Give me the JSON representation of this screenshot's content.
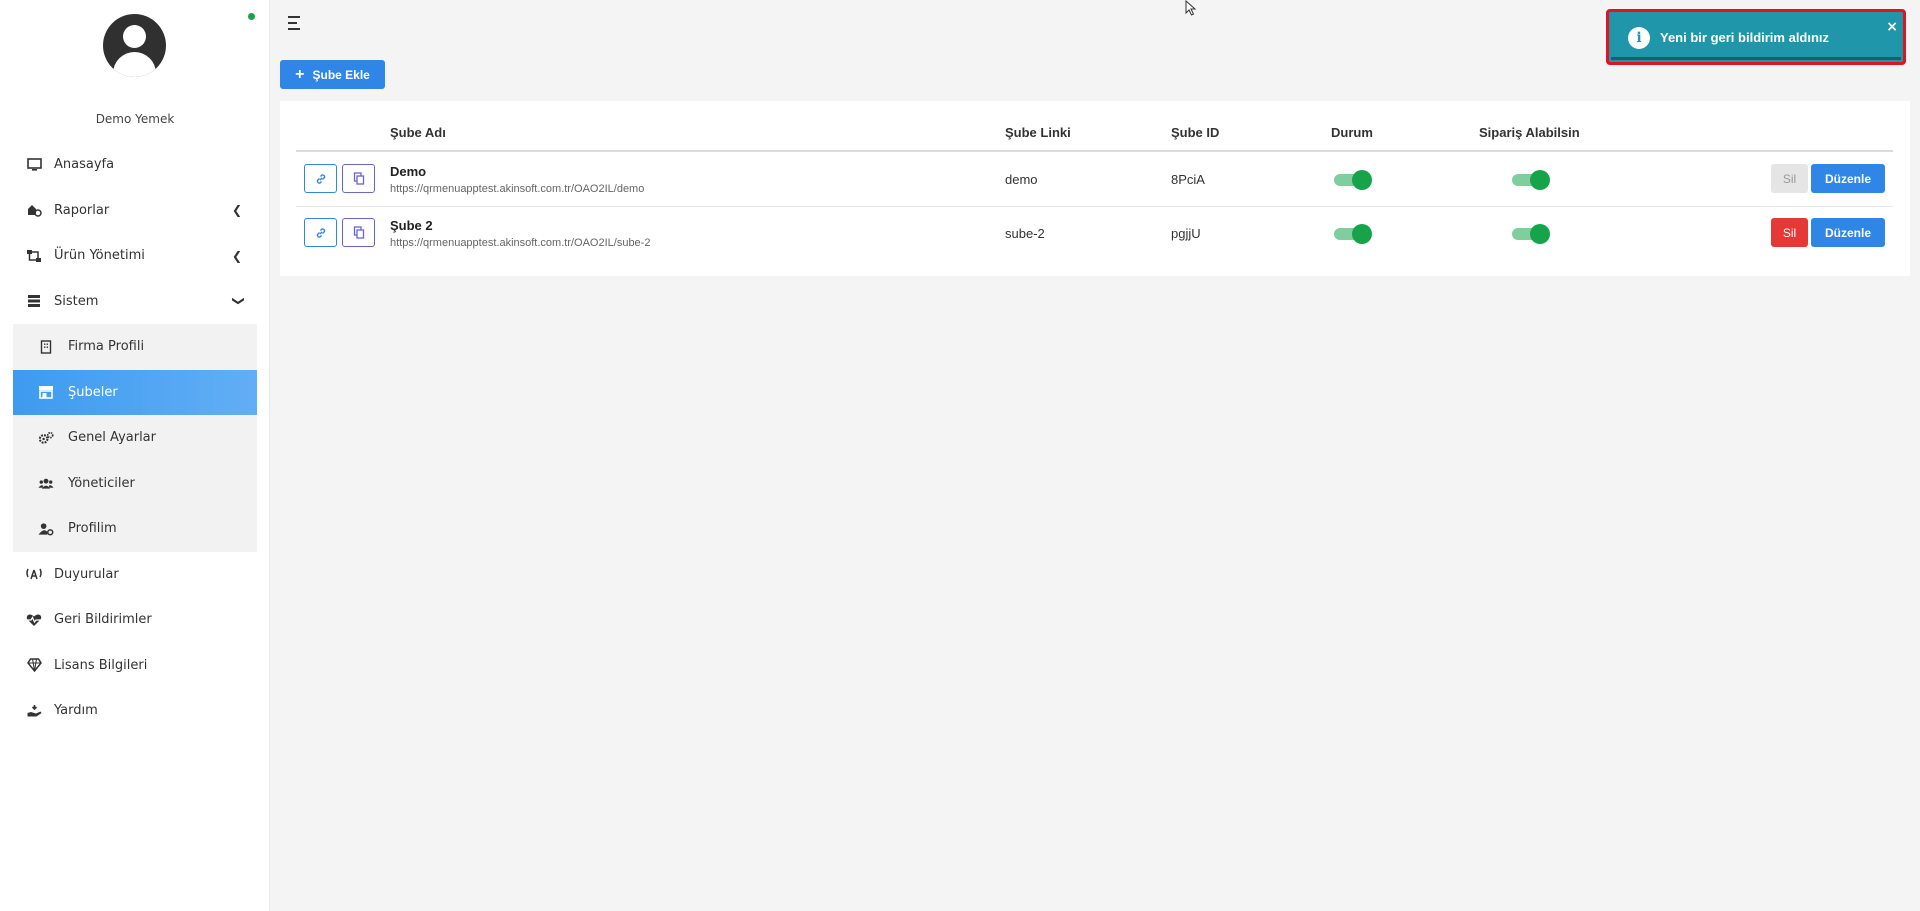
{
  "sidebar": {
    "profile_name": "Demo Yemek",
    "items": [
      {
        "label": "Anasayfa",
        "icon": "monitor-icon"
      },
      {
        "label": "Raporlar",
        "icon": "reports-icon"
      },
      {
        "label": "Ürün Yönetimi",
        "icon": "sitemap-icon"
      },
      {
        "label": "Sistem",
        "icon": "server-icon"
      },
      {
        "label": "Duyurular",
        "icon": "broadcast-icon"
      },
      {
        "label": "Geri Bildirimler",
        "icon": "heart-pulse-icon"
      },
      {
        "label": "Lisans Bilgileri",
        "icon": "diamond-icon"
      },
      {
        "label": "Yardım",
        "icon": "help-hand-icon"
      }
    ],
    "submenu": [
      {
        "label": "Firma Profili",
        "icon": "building-icon"
      },
      {
        "label": "Şubeler",
        "icon": "store-icon"
      },
      {
        "label": "Genel Ayarlar",
        "icon": "cogs-icon"
      },
      {
        "label": "Yöneticiler",
        "icon": "users-icon"
      },
      {
        "label": "Profilim",
        "icon": "user-cog-icon"
      }
    ]
  },
  "toolbar": {
    "add_label": "Şube Ekle"
  },
  "table": {
    "headers": [
      "Şube Adı",
      "Şube Linki",
      "Şube ID",
      "Durum",
      "Sipariş Alabilsin"
    ],
    "rows": [
      {
        "name": "Demo",
        "url": "https://qrmenuapptest.akinsoft.com.tr/OAO2IL/demo",
        "link": "demo",
        "id": "8PciA",
        "durum": true,
        "siparis": true,
        "delete_label": "Sil",
        "delete_enabled": false,
        "edit_label": "Düzenle"
      },
      {
        "name": "Şube 2",
        "url": "https://qrmenuapptest.akinsoft.com.tr/OAO2IL/sube-2",
        "link": "sube-2",
        "id": "pgjjU",
        "durum": true,
        "siparis": true,
        "delete_label": "Sil",
        "delete_enabled": true,
        "edit_label": "Düzenle"
      }
    ]
  },
  "toast": {
    "message": "Yeni bir geri bildirim aldınız",
    "close": "×",
    "icon": "info-icon"
  },
  "colors": {
    "primary": "#2f86e6",
    "success": "#16a34a",
    "danger": "#e53935",
    "toast": "#1f96aa"
  }
}
